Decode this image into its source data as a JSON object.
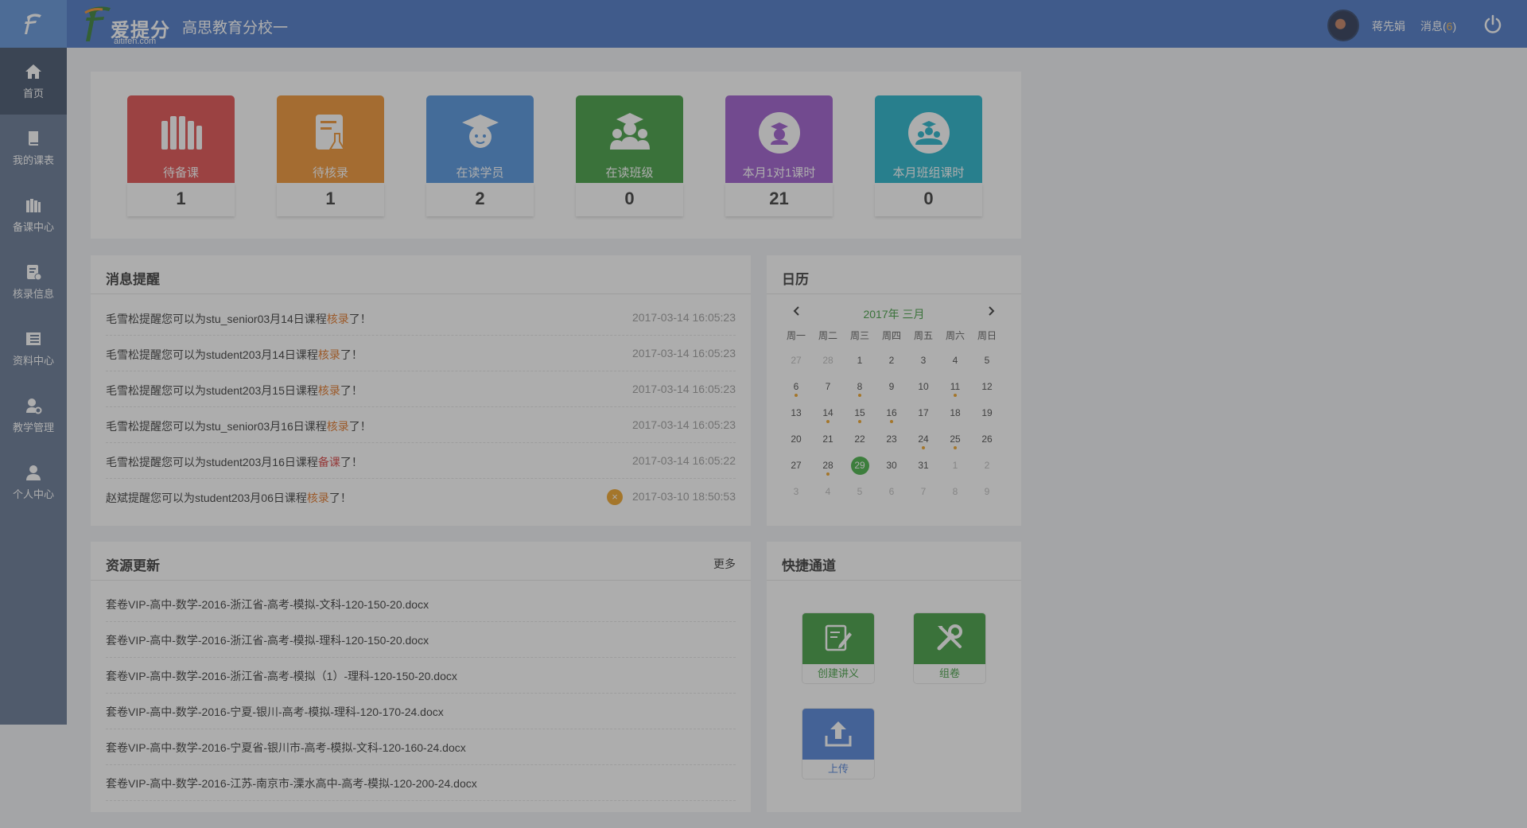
{
  "header": {
    "brand_name": "爱提分",
    "brand_domain": "aitifen.com",
    "school_name": "高思教育分校一",
    "user_name": "蒋先娟",
    "messages_label": "消息(",
    "messages_count": "6",
    "messages_close": ")"
  },
  "sidebar": {
    "items": [
      {
        "label": "首页",
        "icon": "home-icon"
      },
      {
        "label": "我的课表",
        "icon": "book-icon"
      },
      {
        "label": "备课中心",
        "icon": "books-icon"
      },
      {
        "label": "核录信息",
        "icon": "record-icon"
      },
      {
        "label": "资料中心",
        "icon": "list-icon"
      },
      {
        "label": "教学管理",
        "icon": "teacher-gear-icon"
      },
      {
        "label": "个人中心",
        "icon": "user-icon"
      }
    ]
  },
  "stats": [
    {
      "label": "待备课",
      "value": "1",
      "color": "#e04848",
      "icon": "books-icon"
    },
    {
      "label": "待核录",
      "value": "1",
      "color": "#f0902a",
      "icon": "record-icon"
    },
    {
      "label": "在读学员",
      "value": "2",
      "color": "#4a90dc",
      "icon": "student-icon"
    },
    {
      "label": "在读班级",
      "value": "0",
      "color": "#3a9a3a",
      "icon": "class-icon"
    },
    {
      "label": "本月1对1课时",
      "value": "21",
      "color": "#9a55cc",
      "icon": "clock-student-icon"
    },
    {
      "label": "本月班组课时",
      "value": "0",
      "color": "#1ab0c8",
      "icon": "clock-group-icon"
    }
  ],
  "messages": {
    "title": "消息提醒",
    "items": [
      {
        "prefix": "毛雪松提醒您可以为stu_senior03月14日课程",
        "action": "核录",
        "suffix": "了！",
        "time": "2017-03-14 16:05:23"
      },
      {
        "prefix": "毛雪松提醒您可以为student203月14日课程",
        "action": "核录",
        "suffix": "了！",
        "time": "2017-03-14 16:05:23"
      },
      {
        "prefix": "毛雪松提醒您可以为student203月15日课程",
        "action": "核录",
        "suffix": "了！",
        "time": "2017-03-14 16:05:23"
      },
      {
        "prefix": "毛雪松提醒您可以为stu_senior03月16日课程",
        "action": "核录",
        "suffix": "了！",
        "time": "2017-03-14 16:05:23"
      },
      {
        "prefix": "毛雪松提醒您可以为student203月16日课程",
        "action": "备课",
        "suffix": "了！",
        "time": "2017-03-14 16:05:22"
      },
      {
        "prefix": "赵斌提醒您可以为student203月06日课程",
        "action": "核录",
        "suffix": "了！",
        "time": "2017-03-10 18:50:53"
      }
    ]
  },
  "calendar": {
    "title": "日历",
    "month_label": "2017年 三月",
    "weekdays": [
      "周一",
      "周二",
      "周三",
      "周四",
      "周五",
      "周六",
      "周日"
    ],
    "weeks": [
      [
        "27",
        "28",
        "1",
        "2",
        "3",
        "4",
        "5"
      ],
      [
        "6",
        "7",
        "8",
        "9",
        "10",
        "11",
        "12"
      ],
      [
        "13",
        "14",
        "15",
        "16",
        "17",
        "18",
        "19"
      ],
      [
        "20",
        "21",
        "22",
        "23",
        "24",
        "25",
        "26"
      ],
      [
        "27",
        "28",
        "29",
        "30",
        "31",
        "1",
        "2"
      ],
      [
        "3",
        "4",
        "5",
        "6",
        "7",
        "8",
        "9"
      ]
    ],
    "today": "29"
  },
  "resources": {
    "title": "资源更新",
    "more_label": "更多",
    "items": [
      "套卷VIP-高中-数学-2016-浙江省-高考-模拟-文科-120-150-20.docx",
      "套卷VIP-高中-数学-2016-浙江省-高考-模拟-理科-120-150-20.docx",
      "套卷VIP-高中-数学-2016-浙江省-高考-模拟（1）-理科-120-150-20.docx",
      "套卷VIP-高中-数学-2016-宁夏-银川-高考-模拟-理科-120-170-24.docx",
      "套卷VIP-高中-数学-2016-宁夏省-银川市-高考-模拟-文科-120-160-24.docx",
      "套卷VIP-高中-数学-2016-江苏-南京市-溧水高中-高考-模拟-120-200-24.docx"
    ]
  },
  "quick": {
    "title": "快捷通道",
    "items": [
      {
        "label": "创建讲义",
        "color": "#3a9a3a",
        "icon": "edit-doc-icon"
      },
      {
        "label": "组卷",
        "color": "#3a9a3a",
        "icon": "tools-icon"
      },
      {
        "label": "上传",
        "color": "#4a7ed8",
        "icon": "upload-icon"
      }
    ]
  }
}
